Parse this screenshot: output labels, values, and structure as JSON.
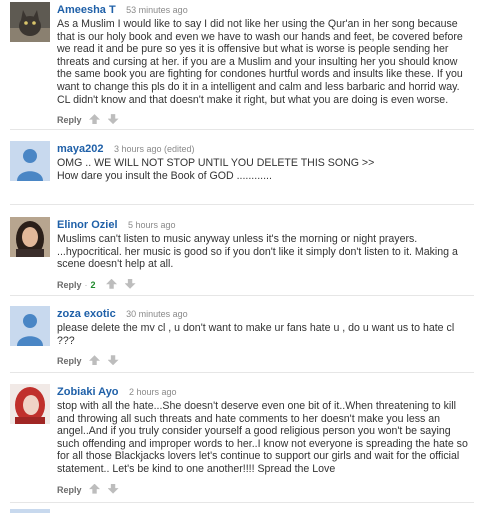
{
  "comments": [
    {
      "author": "Ameesha T",
      "time": "53 minutes ago",
      "text": "As a Muslim I would like to say I did not like her using the Qur'an in her song because that is our holy book and even we have to wash our hands and feet, be covered before we read it and be pure so yes it is offensive but what is worse is people sending her threats and cursing at her. if you are a Muslim and your insulting her you should know the same book you are fighting for condones hurtful words and insults like these. If you want to change this pls do it in a intelligent and calm and less barbaric and horrid way. CL didn't know and that doesn't make it right, but what you are doing is even worse.",
      "reply": "Reply",
      "avatar": "cat-photo-avatar"
    },
    {
      "author": "maya202",
      "time": "3 hours ago (edited)",
      "line1": "OMG ..   WE WILL NOT STOP UNTIL YOU DELETE THIS SONG >>",
      "line2": "How dare you insult the Book of GOD ............",
      "avatar": "default-user-avatar"
    },
    {
      "author": "Elinor Oziel",
      "time": "5 hours ago",
      "line1": "Muslims can't listen to music anyway unless it's the morning or night prayers.",
      "line2": "...hypocritical. her music is good so if you don't like it simply don't listen to it. Making a scene doesn't help at all.",
      "reply": "Reply",
      "likes": "2",
      "avatar": "woman-photo-avatar"
    },
    {
      "author": "zoza exotic",
      "time": "30 minutes ago",
      "text": "please delete the mv cl , u don't want to make ur fans hate u , do u want us to hate cl ???",
      "reply": "Reply",
      "avatar": "default-user-avatar"
    },
    {
      "author": "Zobiaki Ayo",
      "time": "2 hours ago",
      "text": "stop with all the hate...She doesn't deserve even one bit of it..When threatening to kill and throwing all such threats and hate comments to her doesn't make you less an angel..And if you truly consider yourself a good religious person you won't be saying such offending and improper words to her..I know not everyone is spreading the hate so for all those Blackjacks lovers let's continue to support our girls and wait for the official statement.. Let's be kind to one another!!!! Spread the Love",
      "reply": "Reply",
      "avatar": "red-hair-photo-avatar"
    }
  ],
  "colors": {
    "author": "#1f60a8",
    "likes": "#1f8a2c",
    "avatar_bg": "#c8d9ee"
  }
}
